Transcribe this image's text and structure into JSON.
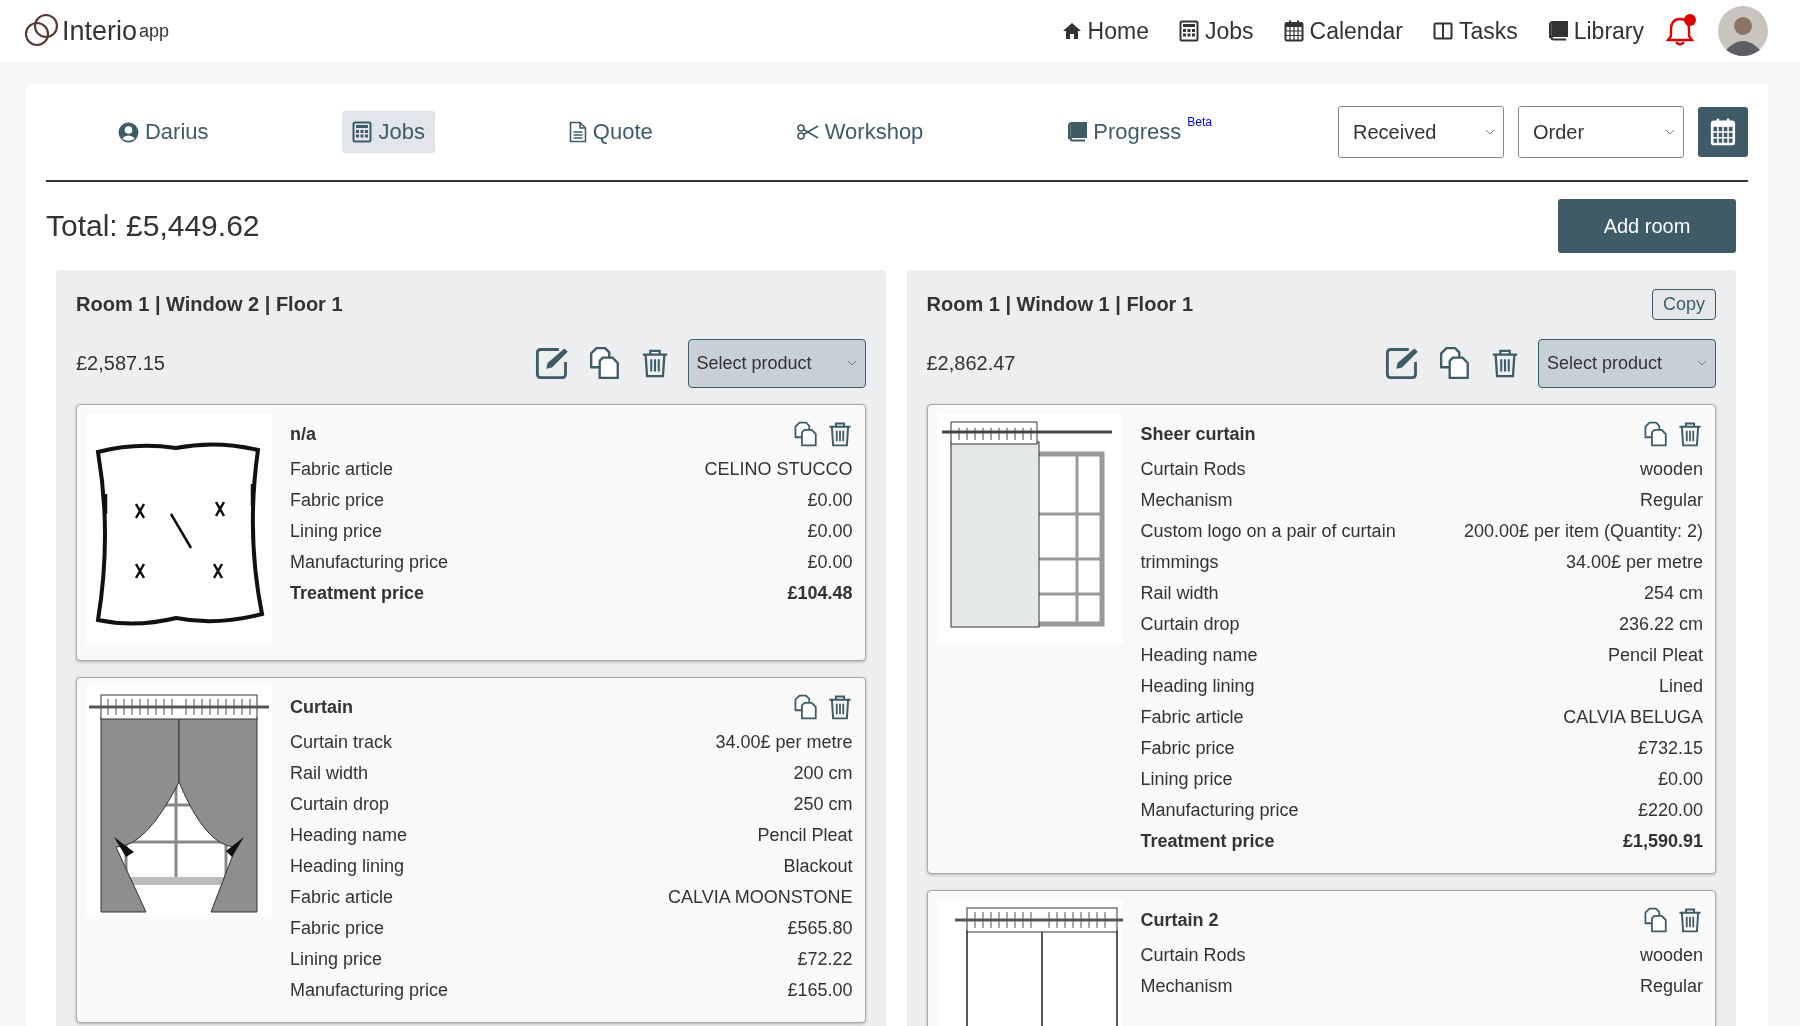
{
  "header": {
    "logo": {
      "name": "Interio",
      "suffix": "app"
    },
    "nav": [
      {
        "label": "Home"
      },
      {
        "label": "Jobs"
      },
      {
        "label": "Calendar"
      },
      {
        "label": "Tasks"
      },
      {
        "label": "Library"
      }
    ],
    "notification": true
  },
  "toolbar": {
    "tabs": [
      {
        "label": "Darius",
        "selected": false
      },
      {
        "label": "Jobs",
        "selected": true
      },
      {
        "label": "Quote",
        "selected": false
      },
      {
        "label": "Workshop",
        "selected": false
      },
      {
        "label": "Progress",
        "badge": "Beta",
        "selected": false
      }
    ],
    "selects": [
      {
        "value": "Received"
      },
      {
        "value": "Order"
      }
    ]
  },
  "total": "Total: £5,449.62",
  "add_button": "Add room",
  "rooms": [
    {
      "title": "Room 1 | Window 2 | Floor 1",
      "price": "£2,587.15",
      "product_select": "Select product",
      "products": [
        {
          "kind": "cushion",
          "name": "n/a",
          "rows": [
            {
              "label": "Fabric article",
              "value": "CELINO STUCCO",
              "total": false
            },
            {
              "label": "Fabric price",
              "value": "£0.00",
              "total": false
            },
            {
              "label": "Lining price",
              "value": "£0.00",
              "total": false
            },
            {
              "label": "Manufacturing price",
              "value": "£0.00",
              "total": false
            },
            {
              "label": "Treatment price",
              "value": "£104.48",
              "total": true
            }
          ]
        },
        {
          "kind": "curtain",
          "name": "Curtain",
          "rows": [
            {
              "label": "Curtain track",
              "value": "34.00£ per metre",
              "total": false
            },
            {
              "label": "Rail width",
              "value": "200 cm",
              "total": false
            },
            {
              "label": "Curtain drop",
              "value": "250 cm",
              "total": false
            },
            {
              "label": "Heading name",
              "value": "Pencil Pleat",
              "total": false
            },
            {
              "label": "Heading lining",
              "value": "Blackout",
              "total": false
            },
            {
              "label": "Fabric article",
              "value": "CALVIA MOONSTONE",
              "total": false
            },
            {
              "label": "Fabric price",
              "value": "£565.80",
              "total": false
            },
            {
              "label": "Lining price",
              "value": "£72.22",
              "total": false
            },
            {
              "label": "Manufacturing price",
              "value": "£165.00",
              "total": false
            }
          ]
        }
      ]
    },
    {
      "title": "Room 1 | Window 1 | Floor 1",
      "copy_button": "Copy",
      "price": "£2,862.47",
      "product_select": "Select product",
      "products": [
        {
          "kind": "sheer",
          "name": "Sheer curtain",
          "rows": [
            {
              "label": "Curtain Rods",
              "value": "wooden",
              "total": false
            },
            {
              "label": "Mechanism",
              "value": "Regular",
              "total": false
            },
            {
              "label": "Custom logo on a pair of curtain",
              "value": "200.00£ per item (Quantity: 2)",
              "total": false
            },
            {
              "label": "trimmings",
              "value": "34.00£ per metre",
              "total": false
            },
            {
              "label": "Rail width",
              "value": "254 cm",
              "total": false
            },
            {
              "label": "Curtain drop",
              "value": "236.22 cm",
              "total": false
            },
            {
              "label": "Heading name",
              "value": "Pencil Pleat",
              "total": false
            },
            {
              "label": "Heading lining",
              "value": "Lined",
              "total": false
            },
            {
              "label": "Fabric article",
              "value": "CALVIA BELUGA",
              "total": false
            },
            {
              "label": "Fabric price",
              "value": "£732.15",
              "total": false
            },
            {
              "label": "Lining price",
              "value": "£0.00",
              "total": false
            },
            {
              "label": "Manufacturing price",
              "value": "£220.00",
              "total": false
            },
            {
              "label": "Treatment price",
              "value": "£1,590.91",
              "total": true
            }
          ]
        },
        {
          "kind": "pair",
          "name": "Curtain 2",
          "rows": [
            {
              "label": "Curtain Rods",
              "value": "wooden",
              "total": false
            },
            {
              "label": "Mechanism",
              "value": "Regular",
              "total": false
            }
          ]
        }
      ]
    }
  ]
}
